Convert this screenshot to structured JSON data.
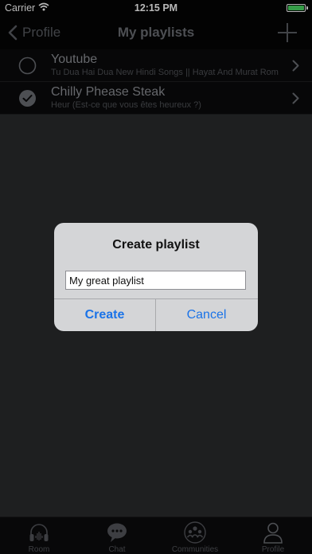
{
  "status_bar": {
    "carrier": "Carrier",
    "time": "12:15 PM",
    "battery_color": "#4cd964"
  },
  "nav": {
    "back_label": "Profile",
    "title": "My playlists",
    "add_icon": "plus-icon"
  },
  "playlists": [
    {
      "title": "Youtube",
      "subtitle": "Tu Dua Hai Dua New Hindi Songs || Hayat And Murat Rom",
      "selected": false
    },
    {
      "title": "Chilly Phease Steak",
      "subtitle": "Heur (Est-ce que vous êtes heureux ?)",
      "selected": true
    }
  ],
  "dialog": {
    "title": "Create playlist",
    "input_value": "My great playlist",
    "create_label": "Create",
    "cancel_label": "Cancel",
    "button_color": "#1a73e8"
  },
  "tabs": [
    {
      "label": "Room",
      "icon": "headphones-icon"
    },
    {
      "label": "Chat",
      "icon": "chat-bubble-icon"
    },
    {
      "label": "Communities",
      "icon": "communities-icon"
    },
    {
      "label": "Profile",
      "icon": "person-icon"
    }
  ]
}
